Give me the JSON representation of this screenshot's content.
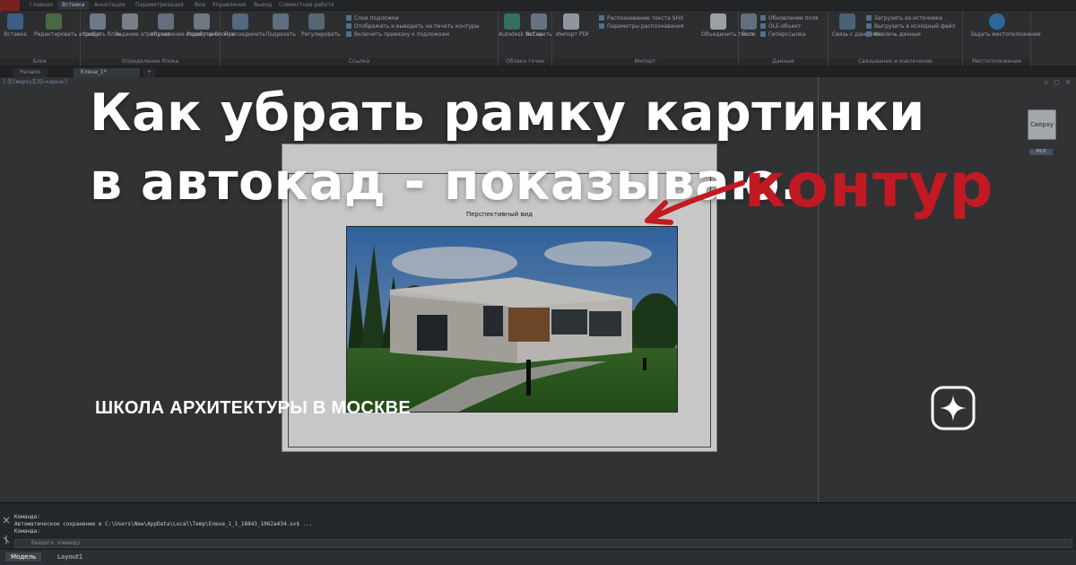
{
  "ribbon": {
    "tabs": [
      "Главная",
      "Вставка",
      "Аннотации",
      "Параметризация",
      "Вид",
      "Управление",
      "Вывод",
      "Совместная работа"
    ],
    "active_tab": "Вставка",
    "block_buttons": [
      "Вставка",
      "Редактировать атрибут"
    ],
    "block_title": "Блок",
    "blockdef_buttons": [
      "Создать блок",
      "Задание атрибутов",
      "Управление атрибутами",
      "Редактор блоков"
    ],
    "blockdef_title": "Определение блока",
    "ref_buttons": [
      "Присоединить",
      "Подрезать",
      "Регулировать"
    ],
    "ref_list": [
      "Слои подложки",
      "Отображать и выводить на печать контуры",
      "Включить привязку к подложкам"
    ],
    "ref_title": "Ссылка",
    "pointcloud_buttons": [
      "Autodesk ReCap",
      "Вставить"
    ],
    "pointcloud_title": "Облако точек",
    "import_buttons": [
      "Импорт PDF"
    ],
    "import_list": [
      "Распознавание текста SHX",
      "Параметры распознавания"
    ],
    "import_button2": "Объединить текст",
    "import_title": "Импорт",
    "data_buttons": [
      "Поле"
    ],
    "data_list": [
      "Обновление поля",
      "OLE-объект",
      "Гиперссылка"
    ],
    "data_title": "Данные",
    "link_buttons": [
      "Связь с данными"
    ],
    "link_list": [
      "Загрузить из источника",
      "Выгрузить в исходный файл",
      "Извлечь данные"
    ],
    "link_title": "Связывание и извлечение",
    "geo_buttons": [
      "Задать местоположение"
    ],
    "geo_title": "Местоположение"
  },
  "doc_tabs": [
    "Начало",
    "Елена_1*"
  ],
  "canvas": {
    "viewport_label": "[-][Сверху][2D-каркас]",
    "sheet_caption": "Перспективный вид",
    "viewcube_label": "Сверху",
    "viewcube_sub": "МСК"
  },
  "overlay": {
    "headline": "Как убрать рамку картинки в автокад - показываю.",
    "annotation": "контур",
    "school": "ШКОЛА АРХИТЕКТУРЫ В МОСКВЕ"
  },
  "command": {
    "line1": "Команда:",
    "line2": "Автоматическое сохранение в C:\\Users\\New\\AppData\\Local\\Temp\\Елена_1_1_18843_1062a434.sv$ ...",
    "line3": "Команда:",
    "placeholder": "Введите команду"
  },
  "status_tabs": [
    "Модель",
    "Layout1"
  ],
  "colors": {
    "annotation_red": "#c11a22",
    "headline_white": "#ffffff"
  }
}
